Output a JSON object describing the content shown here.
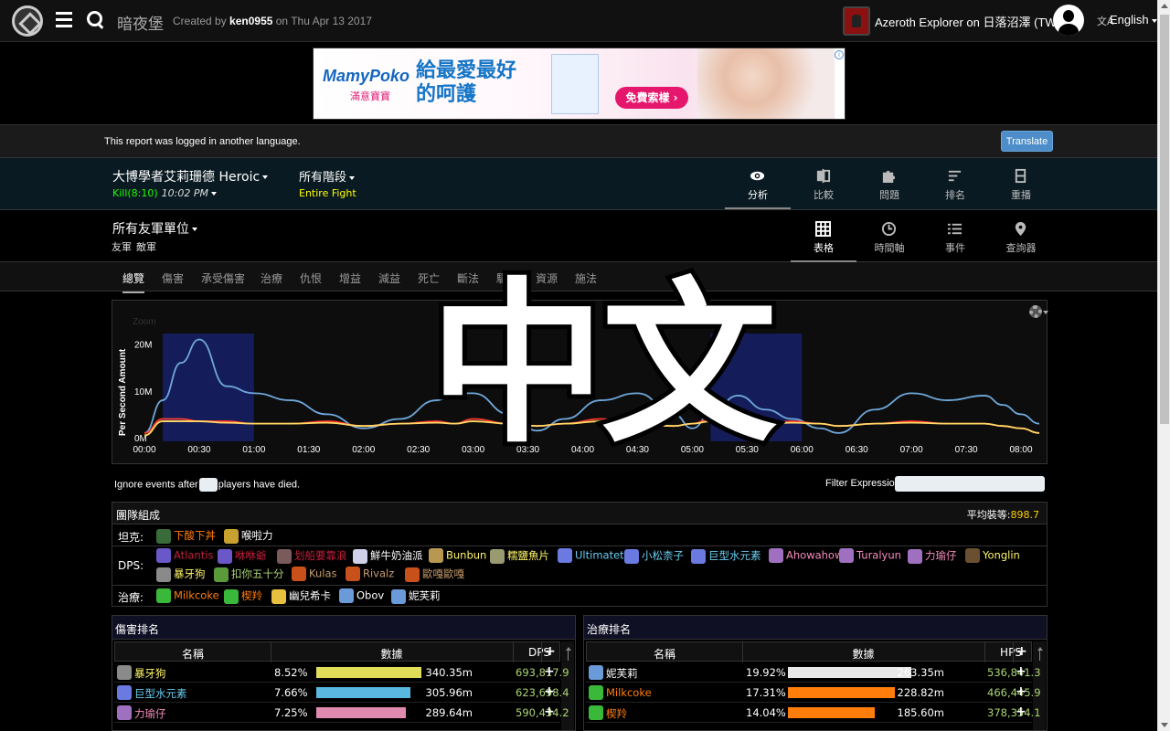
{
  "header": {
    "site_name": "暗夜堡",
    "created_prefix": "Created by ",
    "created_user": "ken0955",
    "created_suffix": " on Thu Apr 13 2017",
    "guild": "Azeroth Explorer on 日落沼澤 (TW)",
    "language": "English"
  },
  "ad": {
    "brand": "MamyPoko",
    "brand_sub": "滿意寶寶",
    "slogan": "給最愛最好的呵護",
    "cta": "免費索樣 ›"
  },
  "translate": {
    "message": "This report was logged in another language.",
    "button": "Translate"
  },
  "fight": {
    "boss": "大博學者艾莉珊德 Heroic",
    "kill": "Kill(8:10)",
    "time": "10:02 PM",
    "phase": "所有階段",
    "phase_sub": "Entire Fight"
  },
  "view_tabs": [
    {
      "label": "分析",
      "icon": "eye-icon"
    },
    {
      "label": "比較",
      "icon": "compare-icon"
    },
    {
      "label": "問題",
      "icon": "puzzle-icon"
    },
    {
      "label": "排名",
      "icon": "sort-icon"
    },
    {
      "label": "重播",
      "icon": "film-icon"
    }
  ],
  "actors": {
    "select": "所有友軍單位",
    "friendly": "友軍",
    "enemy": "敵軍"
  },
  "mode_tabs": [
    {
      "label": "表格",
      "icon": "grid-icon"
    },
    {
      "label": "時間軸",
      "icon": "clock-icon"
    },
    {
      "label": "事件",
      "icon": "list-icon"
    },
    {
      "label": "查詢器",
      "icon": "pin-icon"
    }
  ],
  "sub_tabs": [
    "總覽",
    "傷害",
    "承受傷害",
    "治療",
    "仇恨",
    "增益",
    "減益",
    "死亡",
    "斷法",
    "驅散",
    "資源",
    "施法"
  ],
  "chart_data": {
    "type": "line",
    "zoom_label": "Zoom",
    "ylabel": "Per Second Amount",
    "y_ticks": [
      "0M",
      "10M",
      "20M"
    ],
    "ylim": [
      0,
      25
    ],
    "x_ticks": [
      "00:00",
      "00:30",
      "01:00",
      "01:30",
      "02:00",
      "02:30",
      "03:00",
      "03:30",
      "04:00",
      "04:30",
      "05:00",
      "05:30",
      "06:00",
      "06:30",
      "07:00",
      "07:30",
      "08:00"
    ],
    "xlim": [
      0,
      490
    ],
    "highlight_ranges": [
      [
        10,
        60
      ],
      [
        310,
        360
      ]
    ],
    "x": [
      0,
      10,
      20,
      30,
      45,
      60,
      80,
      100,
      120,
      140,
      160,
      170,
      180,
      200,
      215,
      230,
      250,
      270,
      290,
      300,
      310,
      325,
      340,
      355,
      370,
      380,
      400,
      420,
      440,
      460,
      470,
      480,
      490
    ],
    "series": [
      {
        "color": "#6fa8dc",
        "values": [
          1,
          8,
          16,
          21,
          11,
          9.5,
          8,
          5,
          2,
          4,
          8,
          9.5,
          9.5,
          5,
          1.5,
          4,
          8,
          9.5,
          5,
          2,
          5,
          9,
          6,
          4,
          2,
          1,
          6,
          9.5,
          8,
          9,
          7,
          5,
          3
        ]
      },
      {
        "color": "#ff3b30",
        "values": [
          1,
          4,
          4,
          3.5,
          3.5,
          3,
          3,
          3.5,
          2.5,
          3,
          3.5,
          3,
          4,
          3,
          2.5,
          3,
          4,
          3,
          2.5,
          3,
          4,
          3,
          3,
          3.5,
          3,
          2.5,
          3,
          3.5,
          3,
          3,
          2.5,
          2,
          1
        ]
      },
      {
        "color": "#ffd966",
        "values": [
          0.5,
          3.5,
          3.5,
          3.5,
          3.2,
          3,
          3,
          3.2,
          2.5,
          3,
          3.2,
          3,
          3.5,
          3,
          2.5,
          3,
          3.5,
          3,
          2.5,
          3,
          3.5,
          3,
          3,
          3.2,
          3,
          2.5,
          3,
          3.2,
          3,
          3,
          2.5,
          2,
          1
        ]
      }
    ]
  },
  "watermark": "中文",
  "filters": {
    "ignore_prefix": "Ignore events after",
    "ignore_suffix": "players have died.",
    "filter_label": "Filter Expression:"
  },
  "composition": {
    "title": "團隊組成",
    "ilvl_label": "平均裝等:",
    "ilvl_value": "898.7",
    "tank_label": "坦克:",
    "dps_label": "DPS:",
    "heal_label": "治療:",
    "tanks": [
      {
        "name": "下酸下丼",
        "color": "#ff7d0a",
        "icon": "#3a6b3a"
      },
      {
        "name": "喉啦力",
        "color": "#ffffff",
        "icon": "#c7a030"
      }
    ],
    "dps_row1": [
      {
        "name": "Atlantis",
        "color": "#c41f3b",
        "icon": "#6a58c8"
      },
      {
        "name": "咻咻爺",
        "color": "#c41f3b",
        "icon": "#6a58c8"
      },
      {
        "name": "划船要靠浪",
        "color": "#c41f3b",
        "icon": "#7a5a5a"
      },
      {
        "name": "鮮牛奶油派",
        "color": "#ffffff",
        "icon": "#d0d0e8"
      },
      {
        "name": "Bunbun",
        "color": "#fff569",
        "icon": "#b89850"
      },
      {
        "name": "糯鹽魚片",
        "color": "#fff569",
        "icon": "#9a9a70"
      },
      {
        "name": "Ultimatet",
        "color": "#69ccf0",
        "icon": "#6a7ae0"
      },
      {
        "name": "小松柰子",
        "color": "#69ccf0",
        "icon": "#6a7ae0"
      },
      {
        "name": "巨型水元素",
        "color": "#69ccf0",
        "icon": "#6a7ae0"
      },
      {
        "name": "Ahowahow",
        "color": "#f58cba",
        "icon": "#a070c0"
      },
      {
        "name": "Turalyun",
        "color": "#f58cba",
        "icon": "#a070c0"
      },
      {
        "name": "力瑜仔",
        "color": "#f58cba",
        "icon": "#a070c0"
      },
      {
        "name": "Yonglin",
        "color": "#fff569",
        "icon": "#6a5030"
      }
    ],
    "dps_row2": [
      {
        "name": "暴牙狗",
        "color": "#fff569",
        "icon": "#8a8a8a"
      },
      {
        "name": "扣你五十分",
        "color": "#abd473",
        "icon": "#5a9a3a"
      },
      {
        "name": "Kulas",
        "color": "#c79c6e",
        "icon": "#c8501a"
      },
      {
        "name": "Rivalz",
        "color": "#c79c6e",
        "icon": "#c8501a"
      },
      {
        "name": "歐嘎歐嘎",
        "color": "#c79c6e",
        "icon": "#c8501a"
      }
    ],
    "healers": [
      {
        "name": "Milkcoke",
        "color": "#ff7d0a",
        "icon": "#3ab83a"
      },
      {
        "name": "楔羚",
        "color": "#ff7d0a",
        "icon": "#3ab83a"
      },
      {
        "name": "幽兒希卡",
        "color": "#ffffff",
        "icon": "#e8c040"
      },
      {
        "name": "Obov",
        "color": "#ffffff",
        "icon": "#6a9ad8"
      },
      {
        "name": "妮芙莉",
        "color": "#ffffff",
        "icon": "#6a9ad8"
      }
    ]
  },
  "damage": {
    "title": "傷害排名",
    "col_name": "名稱",
    "col_amount": "數據",
    "col_rate": "DPS",
    "rows": [
      {
        "name": "暴牙狗",
        "color": "#fff569",
        "icon": "#8a8a8a",
        "pct": "8.52%",
        "share": 0.852,
        "bar": "#e0dc5a",
        "amount": "340.35m",
        "rate": "693,817.9"
      },
      {
        "name": "巨型水元素",
        "color": "#69ccf0",
        "icon": "#6a7ae0",
        "pct": "7.66%",
        "share": 0.766,
        "bar": "#5ab8e0",
        "amount": "305.96m",
        "rate": "623,698.4"
      },
      {
        "name": "力瑜仔",
        "color": "#f58cba",
        "icon": "#a070c0",
        "pct": "7.25%",
        "share": 0.725,
        "bar": "#e08ab0",
        "amount": "289.64m",
        "rate": "590,434.2"
      }
    ]
  },
  "healing": {
    "title": "治療排名",
    "col_name": "名稱",
    "col_amount": "數據",
    "col_rate": "HPS",
    "rows": [
      {
        "name": "妮芙莉",
        "color": "#ffffff",
        "icon": "#6a9ad8",
        "pct": "19.92%",
        "share": 1.0,
        "bar": "#e8e8e8",
        "amount": "263.35m",
        "rate": "536,841.3"
      },
      {
        "name": "Milkcoke",
        "color": "#ff7d0a",
        "icon": "#3ab83a",
        "pct": "17.31%",
        "share": 0.869,
        "bar": "#ff7d0a",
        "amount": "228.82m",
        "rate": "466,445.9"
      },
      {
        "name": "楔羚",
        "color": "#ff7d0a",
        "icon": "#3ab83a",
        "pct": "14.04%",
        "share": 0.705,
        "bar": "#ff7d0a",
        "amount": "185.60m",
        "rate": "378,354.1"
      }
    ]
  }
}
